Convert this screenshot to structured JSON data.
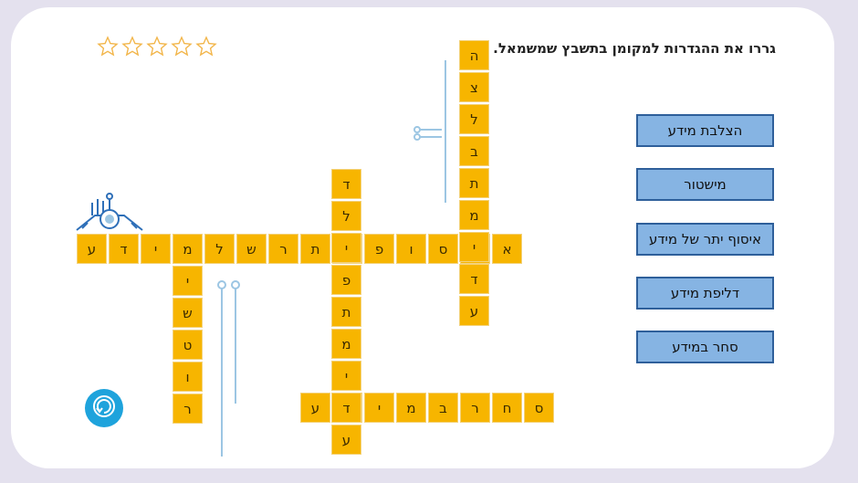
{
  "instruction": "גררו את ההגדרות למקומן בתשבץ שמשמאל.",
  "stars": {
    "total": 5,
    "filled": 0
  },
  "clues": [
    {
      "label": "הצלבת מידע"
    },
    {
      "label": "מישטור"
    },
    {
      "label": "איסוף יתר של מידע"
    },
    {
      "label": "דליפת מידע"
    },
    {
      "label": "סחר במידע"
    }
  ],
  "colors": {
    "cell": "#f7b500",
    "clue_bg": "#86b4e3",
    "clue_border": "#2e5f9a",
    "reset": "#1ea3dc",
    "frame": "#e4e1ee"
  },
  "icons": {
    "reset": "reset-icon",
    "star": "star-outline-icon"
  },
  "crossword": {
    "words": [
      {
        "name": "word-across-row-1",
        "letters": [
          "ע",
          "ד",
          "י",
          "מ",
          "ל",
          "ש",
          "ר",
          "ת",
          "י",
          "פ",
          "ו",
          "ס",
          "י",
          "א"
        ]
      },
      {
        "name": "word-across-row-2",
        "letters": [
          "ע",
          "ד",
          "י",
          "מ",
          "ב",
          "ר",
          "ח",
          "ס"
        ]
      },
      {
        "name": "word-down-col-1",
        "letters": [
          "מ",
          "י",
          "ש",
          "ט",
          "ו",
          "ר"
        ]
      },
      {
        "name": "word-down-col-2",
        "letters": [
          "ד",
          "ל",
          "י",
          "פ",
          "ת",
          "מ",
          "י",
          "ד",
          "ע"
        ]
      },
      {
        "name": "word-down-col-3",
        "letters": [
          "ה",
          "צ",
          "ל",
          "ב",
          "ת",
          "מ",
          "י",
          "ד",
          "ע"
        ]
      }
    ]
  }
}
